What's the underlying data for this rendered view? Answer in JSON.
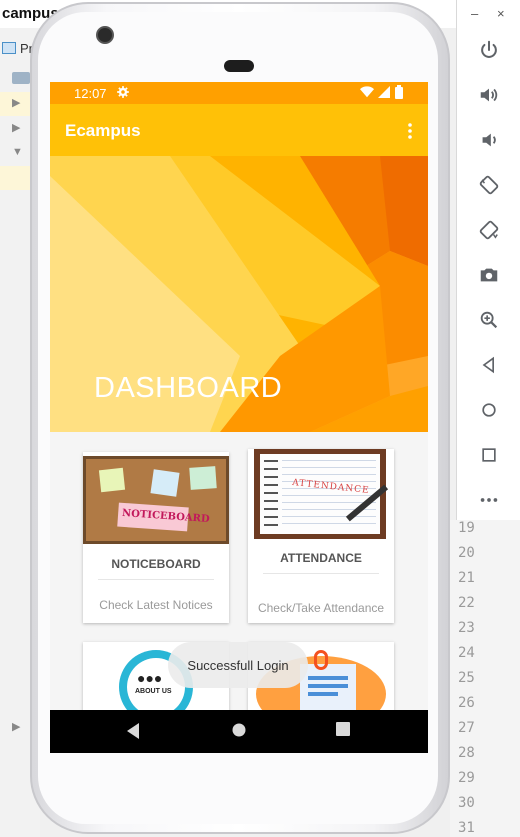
{
  "ide": {
    "project_title": "campus",
    "tab_label": "Pr",
    "line_numbers": [
      "19",
      "20",
      "21",
      "22",
      "23",
      "24",
      "25",
      "26",
      "27",
      "28",
      "29",
      "30",
      "31"
    ]
  },
  "emulator": {
    "toolbar_icons": [
      "power-icon",
      "volume-up-icon",
      "volume-down-icon",
      "rotate-left-icon",
      "rotate-right-icon",
      "camera-icon",
      "zoom-icon",
      "back-icon",
      "home-icon",
      "overview-icon",
      "more-icon"
    ],
    "minimize_glyph": "–",
    "close_glyph": "×"
  },
  "status_bar": {
    "time": "12:07"
  },
  "app_bar": {
    "title": "Ecampus"
  },
  "hero": {
    "title": "DASHBOARD"
  },
  "cards": [
    {
      "title": "NOTICEBOARD",
      "subtitle": "Check Latest Notices",
      "image_text": "NOTICEBOARD"
    },
    {
      "title": "ATTENDANCE",
      "subtitle": "Check/Take Attendance",
      "image_text": "ATTENDANCE"
    },
    {
      "title": "",
      "subtitle": "",
      "image_text": "ABOUT US"
    },
    {
      "title": "",
      "subtitle": "",
      "image_text": ""
    }
  ],
  "toast": {
    "message": "Successfull Login"
  },
  "colors": {
    "status_bar": "#ffa000",
    "app_bar": "#ffc107",
    "nav_bar": "#000000"
  }
}
